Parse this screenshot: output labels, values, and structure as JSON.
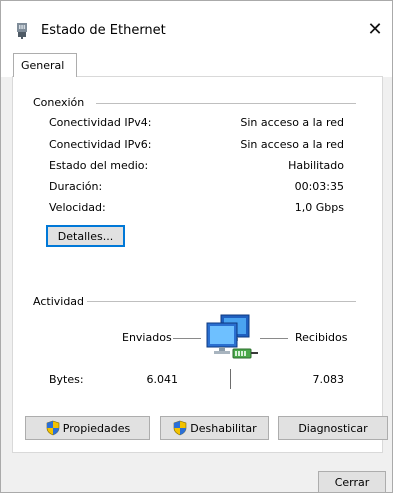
{
  "window": {
    "title": "Estado de Ethernet",
    "close_glyph": "✕"
  },
  "tabs": [
    {
      "label": "General",
      "selected": true
    }
  ],
  "connection": {
    "group_label": "Conexión",
    "rows": [
      {
        "label": "Conectividad IPv4:",
        "value": "Sin acceso a la red"
      },
      {
        "label": "Conectividad IPv6:",
        "value": "Sin acceso a la red"
      },
      {
        "label": "Estado del medio:",
        "value": "Habilitado"
      },
      {
        "label": "Duración:",
        "value": "00:03:35"
      },
      {
        "label": "Velocidad:",
        "value": "1,0 Gbps"
      }
    ],
    "details_button": "Detalles..."
  },
  "activity": {
    "group_label": "Actividad",
    "sent_label": "Enviados",
    "received_label": "Recibidos",
    "bytes_label": "Bytes:",
    "bytes_sent": "6.041",
    "bytes_received": "7.083",
    "icon": "network-computers-icon"
  },
  "actions": {
    "properties": "Propiedades",
    "disable": "Deshabilitar",
    "diagnose": "Diagnosticar"
  },
  "footer": {
    "close_button": "Cerrar"
  },
  "colors": {
    "focus_border": "#0078d7",
    "shield_blue": "#2b6fd6",
    "shield_yellow": "#f2c200"
  }
}
